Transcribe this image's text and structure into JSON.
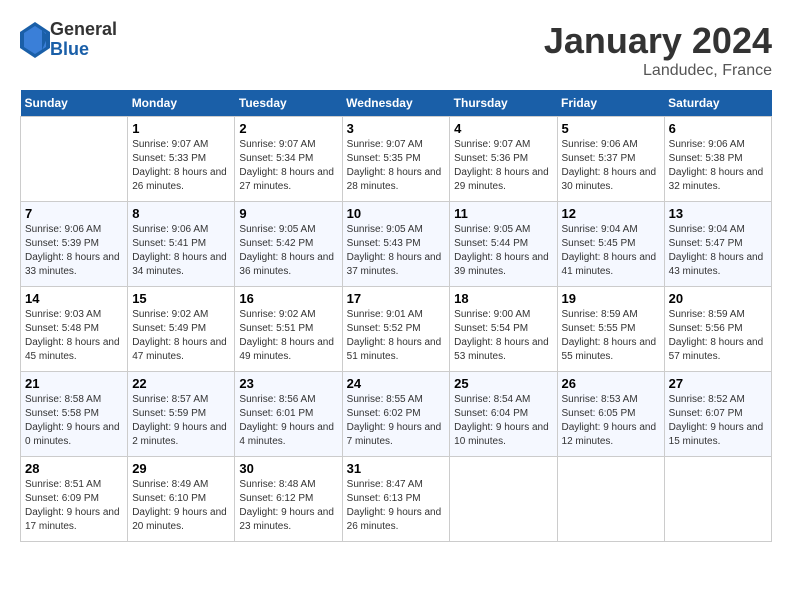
{
  "header": {
    "logo": {
      "general": "General",
      "blue": "Blue"
    },
    "title": "January 2024",
    "location": "Landudec, France"
  },
  "weekdays": [
    "Sunday",
    "Monday",
    "Tuesday",
    "Wednesday",
    "Thursday",
    "Friday",
    "Saturday"
  ],
  "weeks": [
    [
      {
        "day": "",
        "sunrise": "",
        "sunset": "",
        "daylight": ""
      },
      {
        "day": "1",
        "sunrise": "Sunrise: 9:07 AM",
        "sunset": "Sunset: 5:33 PM",
        "daylight": "Daylight: 8 hours and 26 minutes."
      },
      {
        "day": "2",
        "sunrise": "Sunrise: 9:07 AM",
        "sunset": "Sunset: 5:34 PM",
        "daylight": "Daylight: 8 hours and 27 minutes."
      },
      {
        "day": "3",
        "sunrise": "Sunrise: 9:07 AM",
        "sunset": "Sunset: 5:35 PM",
        "daylight": "Daylight: 8 hours and 28 minutes."
      },
      {
        "day": "4",
        "sunrise": "Sunrise: 9:07 AM",
        "sunset": "Sunset: 5:36 PM",
        "daylight": "Daylight: 8 hours and 29 minutes."
      },
      {
        "day": "5",
        "sunrise": "Sunrise: 9:06 AM",
        "sunset": "Sunset: 5:37 PM",
        "daylight": "Daylight: 8 hours and 30 minutes."
      },
      {
        "day": "6",
        "sunrise": "Sunrise: 9:06 AM",
        "sunset": "Sunset: 5:38 PM",
        "daylight": "Daylight: 8 hours and 32 minutes."
      }
    ],
    [
      {
        "day": "7",
        "sunrise": "Sunrise: 9:06 AM",
        "sunset": "Sunset: 5:39 PM",
        "daylight": "Daylight: 8 hours and 33 minutes."
      },
      {
        "day": "8",
        "sunrise": "Sunrise: 9:06 AM",
        "sunset": "Sunset: 5:41 PM",
        "daylight": "Daylight: 8 hours and 34 minutes."
      },
      {
        "day": "9",
        "sunrise": "Sunrise: 9:05 AM",
        "sunset": "Sunset: 5:42 PM",
        "daylight": "Daylight: 8 hours and 36 minutes."
      },
      {
        "day": "10",
        "sunrise": "Sunrise: 9:05 AM",
        "sunset": "Sunset: 5:43 PM",
        "daylight": "Daylight: 8 hours and 37 minutes."
      },
      {
        "day": "11",
        "sunrise": "Sunrise: 9:05 AM",
        "sunset": "Sunset: 5:44 PM",
        "daylight": "Daylight: 8 hours and 39 minutes."
      },
      {
        "day": "12",
        "sunrise": "Sunrise: 9:04 AM",
        "sunset": "Sunset: 5:45 PM",
        "daylight": "Daylight: 8 hours and 41 minutes."
      },
      {
        "day": "13",
        "sunrise": "Sunrise: 9:04 AM",
        "sunset": "Sunset: 5:47 PM",
        "daylight": "Daylight: 8 hours and 43 minutes."
      }
    ],
    [
      {
        "day": "14",
        "sunrise": "Sunrise: 9:03 AM",
        "sunset": "Sunset: 5:48 PM",
        "daylight": "Daylight: 8 hours and 45 minutes."
      },
      {
        "day": "15",
        "sunrise": "Sunrise: 9:02 AM",
        "sunset": "Sunset: 5:49 PM",
        "daylight": "Daylight: 8 hours and 47 minutes."
      },
      {
        "day": "16",
        "sunrise": "Sunrise: 9:02 AM",
        "sunset": "Sunset: 5:51 PM",
        "daylight": "Daylight: 8 hours and 49 minutes."
      },
      {
        "day": "17",
        "sunrise": "Sunrise: 9:01 AM",
        "sunset": "Sunset: 5:52 PM",
        "daylight": "Daylight: 8 hours and 51 minutes."
      },
      {
        "day": "18",
        "sunrise": "Sunrise: 9:00 AM",
        "sunset": "Sunset: 5:54 PM",
        "daylight": "Daylight: 8 hours and 53 minutes."
      },
      {
        "day": "19",
        "sunrise": "Sunrise: 8:59 AM",
        "sunset": "Sunset: 5:55 PM",
        "daylight": "Daylight: 8 hours and 55 minutes."
      },
      {
        "day": "20",
        "sunrise": "Sunrise: 8:59 AM",
        "sunset": "Sunset: 5:56 PM",
        "daylight": "Daylight: 8 hours and 57 minutes."
      }
    ],
    [
      {
        "day": "21",
        "sunrise": "Sunrise: 8:58 AM",
        "sunset": "Sunset: 5:58 PM",
        "daylight": "Daylight: 9 hours and 0 minutes."
      },
      {
        "day": "22",
        "sunrise": "Sunrise: 8:57 AM",
        "sunset": "Sunset: 5:59 PM",
        "daylight": "Daylight: 9 hours and 2 minutes."
      },
      {
        "day": "23",
        "sunrise": "Sunrise: 8:56 AM",
        "sunset": "Sunset: 6:01 PM",
        "daylight": "Daylight: 9 hours and 4 minutes."
      },
      {
        "day": "24",
        "sunrise": "Sunrise: 8:55 AM",
        "sunset": "Sunset: 6:02 PM",
        "daylight": "Daylight: 9 hours and 7 minutes."
      },
      {
        "day": "25",
        "sunrise": "Sunrise: 8:54 AM",
        "sunset": "Sunset: 6:04 PM",
        "daylight": "Daylight: 9 hours and 10 minutes."
      },
      {
        "day": "26",
        "sunrise": "Sunrise: 8:53 AM",
        "sunset": "Sunset: 6:05 PM",
        "daylight": "Daylight: 9 hours and 12 minutes."
      },
      {
        "day": "27",
        "sunrise": "Sunrise: 8:52 AM",
        "sunset": "Sunset: 6:07 PM",
        "daylight": "Daylight: 9 hours and 15 minutes."
      }
    ],
    [
      {
        "day": "28",
        "sunrise": "Sunrise: 8:51 AM",
        "sunset": "Sunset: 6:09 PM",
        "daylight": "Daylight: 9 hours and 17 minutes."
      },
      {
        "day": "29",
        "sunrise": "Sunrise: 8:49 AM",
        "sunset": "Sunset: 6:10 PM",
        "daylight": "Daylight: 9 hours and 20 minutes."
      },
      {
        "day": "30",
        "sunrise": "Sunrise: 8:48 AM",
        "sunset": "Sunset: 6:12 PM",
        "daylight": "Daylight: 9 hours and 23 minutes."
      },
      {
        "day": "31",
        "sunrise": "Sunrise: 8:47 AM",
        "sunset": "Sunset: 6:13 PM",
        "daylight": "Daylight: 9 hours and 26 minutes."
      },
      {
        "day": "",
        "sunrise": "",
        "sunset": "",
        "daylight": ""
      },
      {
        "day": "",
        "sunrise": "",
        "sunset": "",
        "daylight": ""
      },
      {
        "day": "",
        "sunrise": "",
        "sunset": "",
        "daylight": ""
      }
    ]
  ]
}
